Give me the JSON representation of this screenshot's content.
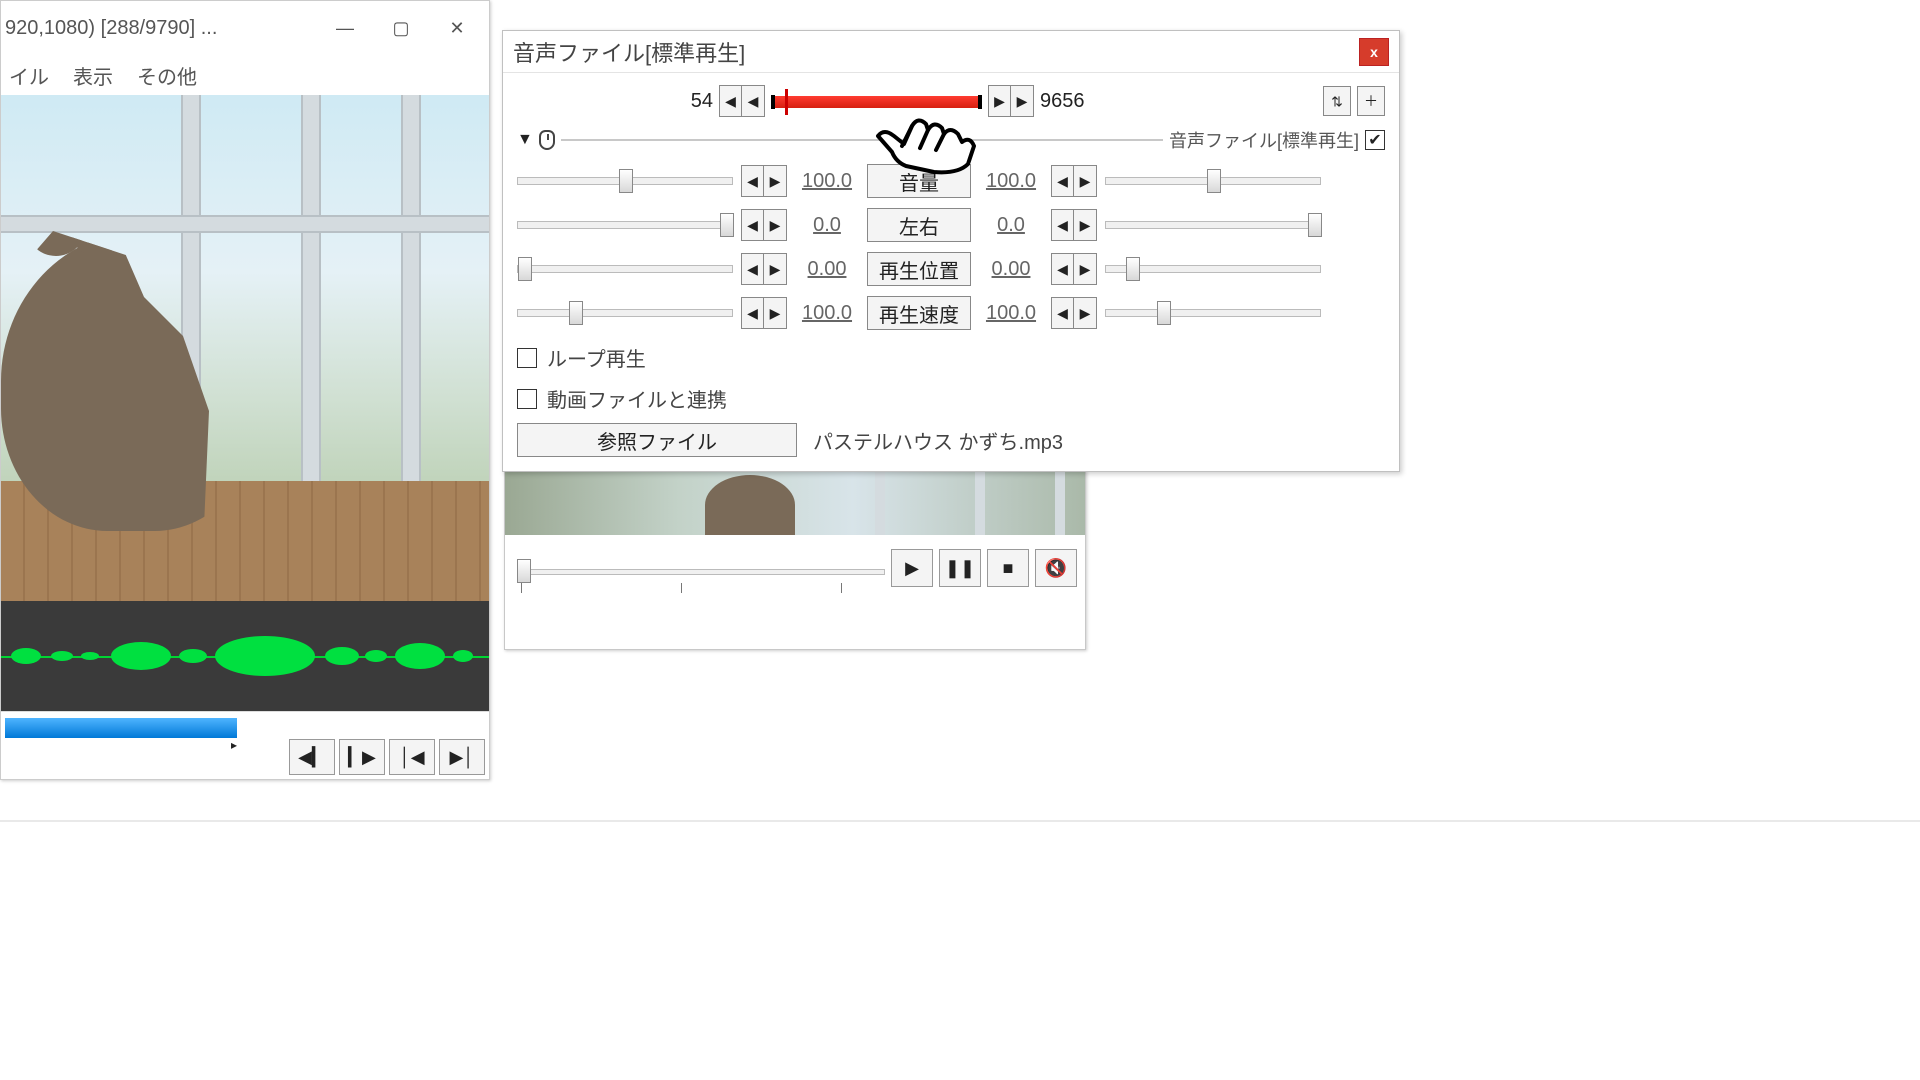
{
  "left_window": {
    "title": "920,1080)  [288/9790]  ...",
    "menu": [
      "イル",
      "表示",
      "その他"
    ]
  },
  "timeline_window": {},
  "dialog": {
    "title": "音声ファイル[標準再生]",
    "close": "x",
    "frame_start": "54",
    "frame_end": "9656",
    "sub_label": "音声ファイル[標準再生]",
    "sub_checked": true,
    "params": [
      {
        "name": "vol",
        "label": "音量",
        "left": "100.0",
        "right": "100.0",
        "lpos": 50,
        "rpos": 50
      },
      {
        "name": "pan",
        "label": "左右",
        "left": "0.0",
        "right": "0.0",
        "lpos": 100,
        "rpos": 100
      },
      {
        "name": "pos",
        "label": "再生位置",
        "left": "0.00",
        "right": "0.00",
        "lpos": 0,
        "rpos": 10
      },
      {
        "name": "speed",
        "label": "再生速度",
        "left": "100.0",
        "right": "100.0",
        "lpos": 25,
        "rpos": 25
      }
    ],
    "loop_label": "ループ再生",
    "loop_checked": false,
    "link_label": "動画ファイルと連携",
    "link_checked": false,
    "ref_button": "参照ファイル",
    "ref_file": "パステルハウス かずち.mp3"
  }
}
